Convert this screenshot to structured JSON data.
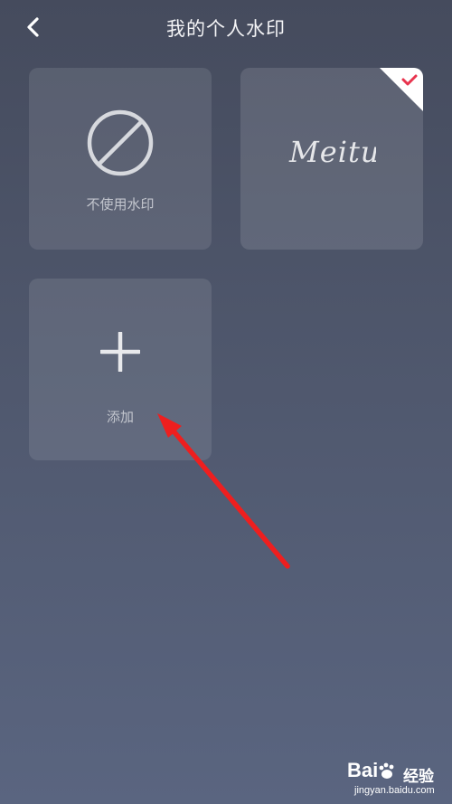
{
  "header": {
    "title": "我的个人水印",
    "back_icon": "chevron-left-icon"
  },
  "cards": [
    {
      "label": "不使用水印",
      "icon": "no-symbol-icon",
      "selected": false
    },
    {
      "label": "Meitu",
      "icon": "meitu-signature-logo",
      "selected": true
    },
    {
      "label": "添加",
      "icon": "plus-icon",
      "selected": false
    }
  ],
  "colors": {
    "accent_check": "#e8344e",
    "annotation_arrow": "#ee1f1f"
  },
  "watermark": {
    "brand": "Bai",
    "brand_suffix": "经验",
    "url": "jingyan.baidu.com"
  }
}
